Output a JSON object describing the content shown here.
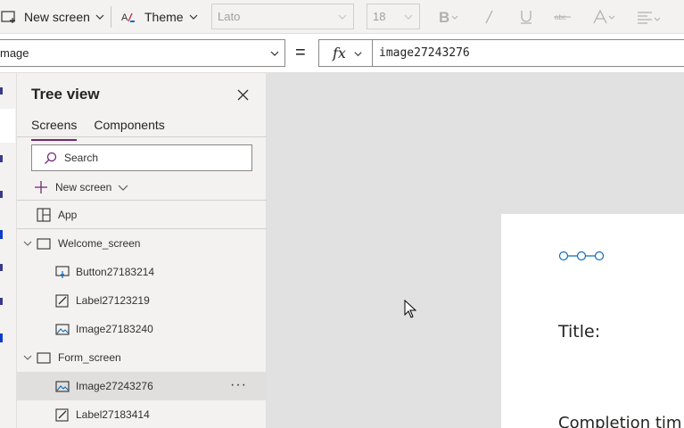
{
  "toolbar": {
    "new_screen_label": "New screen",
    "theme_label": "Theme",
    "font_family": "Lato",
    "font_size": "18",
    "format_icons": [
      "bold-icon",
      "italic-icon",
      "underline-icon",
      "strikethrough-icon",
      "font-color-icon",
      "text-align-icon"
    ]
  },
  "formula_bar": {
    "property": "mage",
    "equals": "=",
    "fx_label": "fx",
    "formula": "image27243276"
  },
  "tree_view": {
    "title": "Tree view",
    "tabs": [
      {
        "label": "Screens",
        "active": true
      },
      {
        "label": "Components",
        "active": false
      }
    ],
    "search_placeholder": "Search",
    "new_screen_label": "New screen",
    "app_label": "App",
    "nodes": [
      {
        "label": "Welcome_screen",
        "type": "screen",
        "expanded": true
      },
      {
        "label": "Button27183214",
        "type": "button"
      },
      {
        "label": "Label27123219",
        "type": "label"
      },
      {
        "label": "Image27183240",
        "type": "image"
      },
      {
        "label": "Form_screen",
        "type": "screen",
        "expanded": true
      },
      {
        "label": "Image27243276",
        "type": "image",
        "selected": true
      },
      {
        "label": "Label27183414",
        "type": "label"
      }
    ],
    "more_label": "···"
  },
  "canvas": {
    "title_label": "Title:",
    "completion_label": "Completion tim"
  },
  "colors": {
    "accent": "#742774",
    "canvas_bg": "#e1e1e1",
    "panel_bg": "#f3f2f1",
    "selected_bg": "#e1dfdd",
    "connector": "#0f6cbd"
  }
}
